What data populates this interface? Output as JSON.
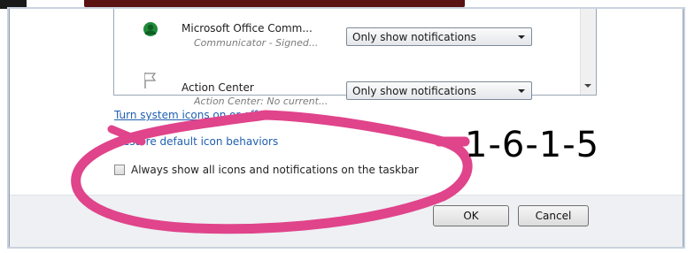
{
  "dialog": {
    "rows": [
      {
        "title": "Microsoft Office Comm...",
        "subtitle": "Communicator - Signed...",
        "behavior": "Only show notifications",
        "icon": "communicator-icon"
      },
      {
        "title": "Action Center",
        "subtitle": "Action Center: No current...",
        "behavior": "Only show notifications",
        "icon": "flag-icon"
      }
    ],
    "links": {
      "turn_system_icons": "Turn system icons on or off",
      "restore_defaults": "estore default icon behaviors"
    },
    "checkbox": {
      "label": "Always show all icons and notifications on the taskbar",
      "checked": false
    },
    "buttons": {
      "ok": "OK",
      "cancel": "Cancel"
    }
  },
  "annotation": {
    "text": "1-6-1-5",
    "stroke_color": "#e0448b"
  },
  "colors": {
    "link": "#1f5fb0",
    "window_border": "#8e9cb0"
  }
}
